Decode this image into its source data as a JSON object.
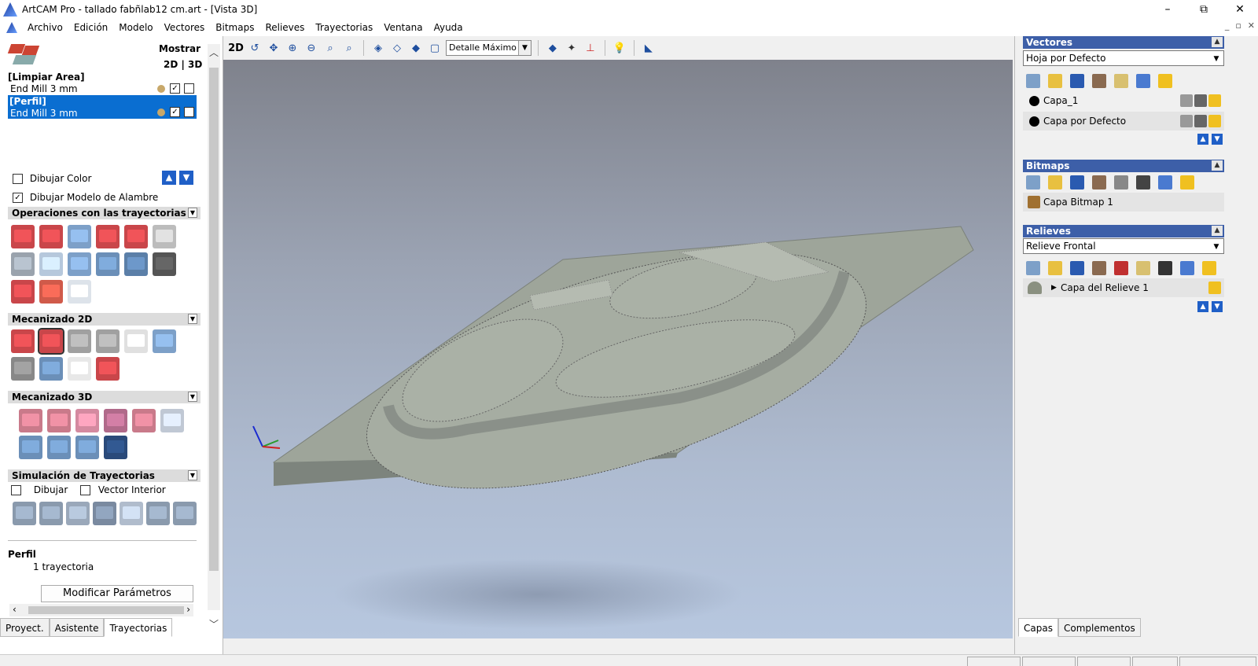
{
  "window": {
    "title": "ArtCAM Pro - tallado fabñlab12 cm.art - [Vista 3D]",
    "minimize": "–",
    "maximize": "⧉",
    "close": "✕"
  },
  "menu": [
    "Archivo",
    "Edición",
    "Modelo",
    "Vectores",
    "Bitmaps",
    "Relieves",
    "Trayectorias",
    "Ventana",
    "Ayuda"
  ],
  "left": {
    "mostrar": "Mostrar",
    "view_2d3d": "2D | 3D",
    "toolpaths": [
      {
        "group": "[Limpiar Area]",
        "tool": "End Mill 3 mm",
        "selected": false
      },
      {
        "group": "[Perfil]",
        "tool": "End Mill 3 mm",
        "selected": true
      }
    ],
    "dibujar_color": "Dibujar Color",
    "dibujar_alambre": "Dibujar Modelo de Alambre",
    "sections": {
      "ops": "Operaciones con las trayectorias",
      "mec2d": "Mecanizado 2D",
      "mec3d": "Mecanizado 3D",
      "sim": "Simulación de Trayectorias"
    },
    "sim_dibujar": "Dibujar",
    "sim_vector": "Vector Interior",
    "info_title": "Perfil",
    "info_count": "1 trayectoria",
    "modify_button": "Modificar Parámetros",
    "tabs": [
      "Proyect.",
      "Asistente",
      "Trayectorias"
    ]
  },
  "toolbar": {
    "mode_2d": "2D",
    "detail": "Detalle Máximo"
  },
  "right": {
    "vectores": {
      "title": "Vectores",
      "sheet": "Hoja por Defecto",
      "layers": [
        "Capa_1",
        "Capa por Defecto"
      ]
    },
    "bitmaps": {
      "title": "Bitmaps",
      "layers": [
        "Capa Bitmap 1"
      ]
    },
    "relieves": {
      "title": "Relieves",
      "sheet": "Relieve Frontal",
      "layers": [
        "Capa del Relieve 1"
      ]
    },
    "tabs": [
      "Capas",
      "Complementos"
    ]
  },
  "colors": {
    "accent": "#3d5fa8",
    "selection": "#0a6ed1",
    "model": "#9ea59a"
  }
}
